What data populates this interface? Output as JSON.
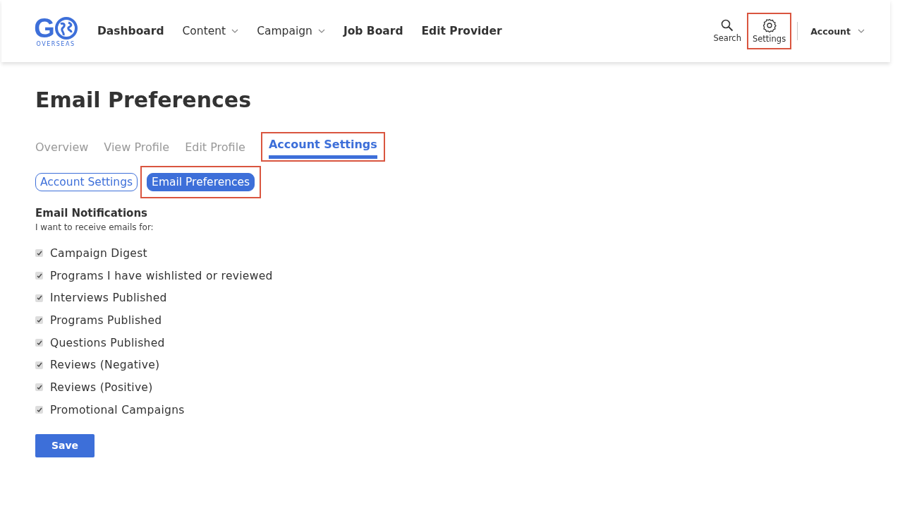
{
  "logo": {
    "letter": "G",
    "tagline": "OVERSEAS"
  },
  "nav": [
    {
      "label": "Dashboard",
      "kind": "link"
    },
    {
      "label": "Content",
      "kind": "dropdown"
    },
    {
      "label": "Campaign",
      "kind": "dropdown"
    },
    {
      "label": "Job Board",
      "kind": "link"
    },
    {
      "label": "Edit Provider",
      "kind": "link"
    }
  ],
  "tools": [
    {
      "label": "Search",
      "kind": "search",
      "highlighted": false
    },
    {
      "label": "Settings",
      "kind": "settings",
      "highlighted": true
    }
  ],
  "account": {
    "label": "Account"
  },
  "page_title": "Email Preferences",
  "tabs": [
    {
      "label": "Overview",
      "selected": false,
      "highlighted": false
    },
    {
      "label": "View Profile",
      "selected": false,
      "highlighted": false
    },
    {
      "label": "Edit Profile",
      "selected": false,
      "highlighted": false
    },
    {
      "label": "Account Settings",
      "selected": true,
      "highlighted": true
    }
  ],
  "subtabs": [
    {
      "label": "Account Settings",
      "selected": false,
      "highlighted": false
    },
    {
      "label": "Email Preferences",
      "selected": true,
      "highlighted": true
    }
  ],
  "section": {
    "title": "Email Notifications",
    "subtitle": "I want to receive emails for:"
  },
  "options": [
    {
      "label": "Campaign Digest",
      "checked": true
    },
    {
      "label": "Programs I have wishlisted or reviewed",
      "checked": true
    },
    {
      "label": "Interviews Published",
      "checked": true
    },
    {
      "label": "Programs Published",
      "checked": true
    },
    {
      "label": "Questions Published",
      "checked": true
    },
    {
      "label": "Reviews (Negative)",
      "checked": true
    },
    {
      "label": "Reviews (Positive)",
      "checked": true
    },
    {
      "label": "Promotional Campaigns",
      "checked": true
    }
  ],
  "save_button": "Save"
}
